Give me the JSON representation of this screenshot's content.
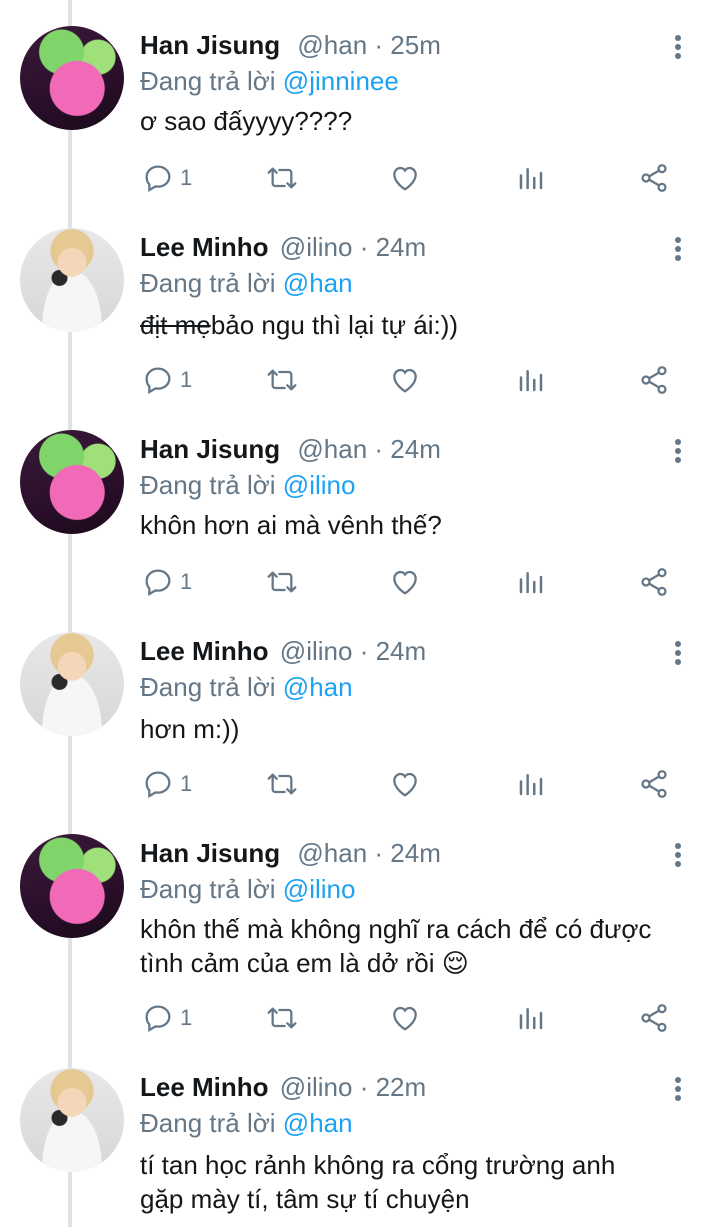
{
  "tweets": [
    {
      "author": "Han Jisung",
      "handle": "@han",
      "time": "25m",
      "avatar": "han-avatar",
      "reply_prefix": "Đang trả lời",
      "reply_to": "@jinninee",
      "strike_text": "",
      "text": "ơ sao đấyyyy????",
      "text2": "",
      "reply_count": "1"
    },
    {
      "author": "Lee Minho",
      "handle": "@ilino",
      "time": "24m",
      "avatar": "minho-avatar",
      "reply_prefix": "Đang trả lời",
      "reply_to": "@han",
      "strike_text": "địt mẹ",
      "text": "bảo ngu thì lại tự ái:))",
      "text2": "",
      "reply_count": "1"
    },
    {
      "author": "Han Jisung",
      "handle": "@han",
      "time": "24m",
      "avatar": "han-avatar",
      "reply_prefix": "Đang trả lời",
      "reply_to": "@ilino",
      "strike_text": "",
      "text": "khôn hơn ai mà vênh thế?",
      "text2": "",
      "reply_count": "1"
    },
    {
      "author": "Lee Minho",
      "handle": "@ilino",
      "time": "24m",
      "avatar": "minho-avatar",
      "reply_prefix": "Đang trả lời",
      "reply_to": "@han",
      "strike_text": "",
      "text": "hơn m:))",
      "text2": "",
      "reply_count": "1"
    },
    {
      "author": "Han Jisung",
      "handle": "@han",
      "time": "24m",
      "avatar": "han-avatar",
      "reply_prefix": "Đang trả lời",
      "reply_to": "@ilino",
      "strike_text": "",
      "text": "khôn thế mà không nghĩ ra cách để có được",
      "text2": "tình cảm của em là dở rồi 😌",
      "reply_count": "1"
    },
    {
      "author": "Lee Minho",
      "handle": "@ilino",
      "time": "22m",
      "avatar": "minho-avatar",
      "reply_prefix": "Đang trả lời",
      "reply_to": "@han",
      "strike_text": "",
      "text": "tí tan học rảnh không ra cổng trường anh",
      "text2": "gặp mày tí, tâm sự tí chuyện",
      "reply_count": ""
    }
  ],
  "separator": "·",
  "icons": {
    "reply": "reply-icon",
    "retweet": "retweet-icon",
    "like": "heart-icon",
    "stats": "stats-icon",
    "share": "share-icon",
    "more": "more-icon"
  },
  "colors": {
    "link": "#1da1f2",
    "muted": "#657786",
    "text": "#14171a",
    "thread": "#dfe3e6"
  }
}
